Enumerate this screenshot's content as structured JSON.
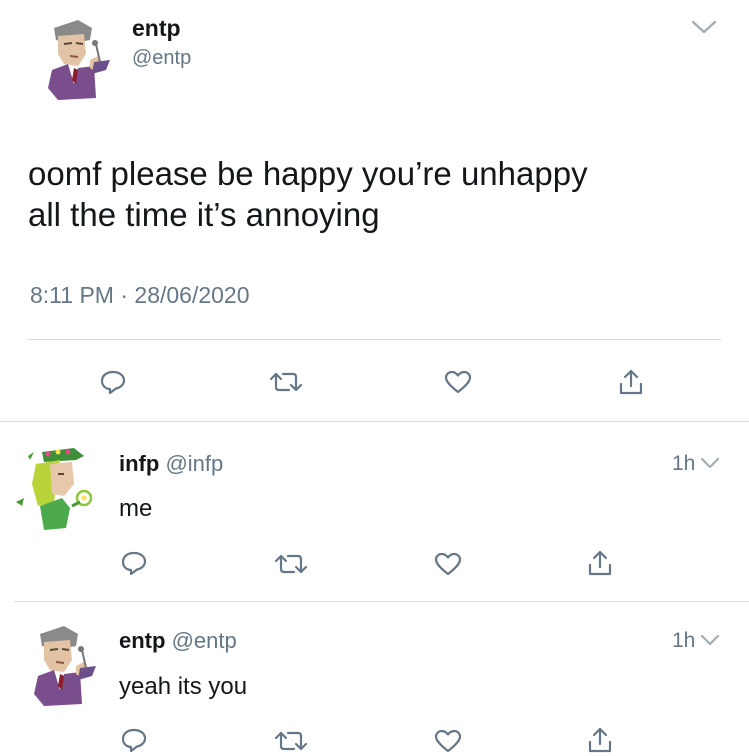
{
  "main_tweet": {
    "author_name": "entp",
    "author_handle": "@entp",
    "text_line1": "oomf please be happy you’re unhappy",
    "text_line2": "all the time it’s annoying",
    "time": "8:11 PM",
    "separator": "·",
    "date": "28/06/2020"
  },
  "replies": [
    {
      "author_name": "infp",
      "author_handle": "@infp",
      "age": "1h",
      "text": "me"
    },
    {
      "author_name": "entp",
      "author_handle": "@entp",
      "age": "1h",
      "text": "yeah its you"
    }
  ],
  "colors": {
    "text": "#14171a",
    "muted": "#657786",
    "divider": "#d7dce0",
    "icon": "#657786"
  },
  "icons": {
    "menu": "chevron-down-icon",
    "reply": "reply-icon",
    "retweet": "retweet-icon",
    "like": "heart-icon",
    "share": "share-icon"
  }
}
